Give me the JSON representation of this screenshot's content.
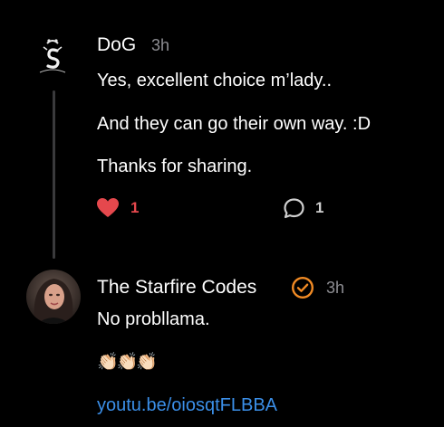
{
  "colors": {
    "background": "#000000",
    "text": "#ffffff",
    "secondary_text": "#8e8e93",
    "like_active": "#e5484d",
    "verified_badge": "#f08a24",
    "link": "#3b8fe8",
    "thread_line": "#3a3a3c"
  },
  "comments": [
    {
      "author": "DoG",
      "time": "3h",
      "avatar_icon": "dog-logo-icon",
      "paragraphs": [
        "Yes, excellent choice m’lady..",
        "And they can go their own way. :D",
        "Thanks for sharing."
      ],
      "likes": "1",
      "liked": true,
      "replies": "1"
    },
    {
      "author": "The Starfire Codes",
      "verified": true,
      "verified_icon": "verified-check-icon",
      "time": "3h",
      "avatar_icon": "user-photo-avatar",
      "paragraphs": [
        "No probllama."
      ],
      "emoji": "👏🏻👏🏻👏🏻",
      "link": "youtu.be/oiosqtFLBBA"
    }
  ]
}
